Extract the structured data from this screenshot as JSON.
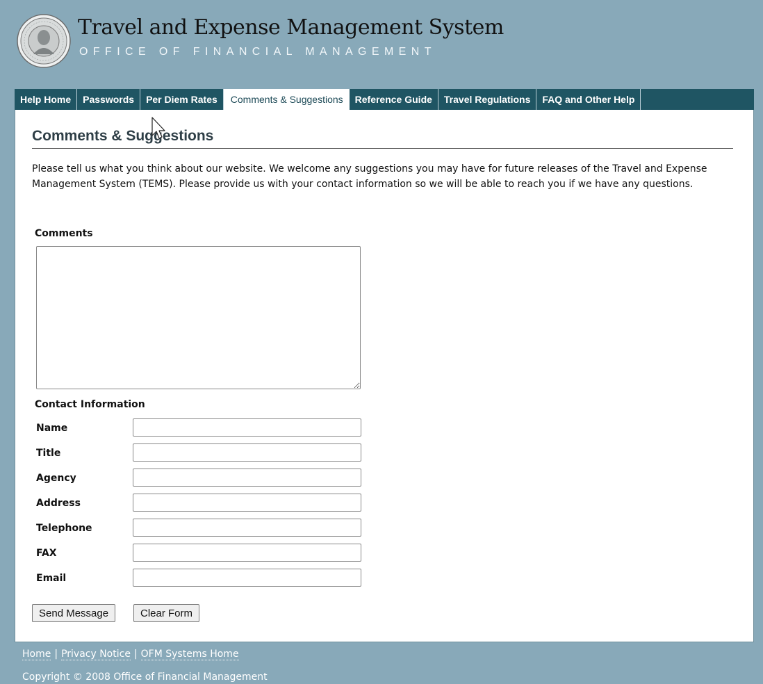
{
  "header": {
    "title": "Travel and Expense Management System",
    "subtitle": "OFFICE OF FINANCIAL MANAGEMENT",
    "seal_icon": "washington-state-seal-icon"
  },
  "nav": {
    "tabs": [
      {
        "label": "Help Home",
        "active": false
      },
      {
        "label": "Passwords",
        "active": false
      },
      {
        "label": "Per Diem Rates",
        "active": false
      },
      {
        "label": "Comments & Suggestions",
        "active": true
      },
      {
        "label": "Reference Guide",
        "active": false
      },
      {
        "label": "Travel Regulations",
        "active": false
      },
      {
        "label": "FAQ and Other Help",
        "active": false
      }
    ]
  },
  "page": {
    "title": "Comments & Suggestions",
    "intro": "Please tell us what you think about our website. We welcome any suggestions you may have for future releases of the Travel and Expense Management System (TEMS). Please provide us with your contact information so we will be able to reach you if we have any questions."
  },
  "form": {
    "comments_label": "Comments",
    "comments_value": "",
    "contact_heading": "Contact Information",
    "fields": {
      "name": {
        "label": "Name",
        "value": ""
      },
      "title": {
        "label": "Title",
        "value": ""
      },
      "agency": {
        "label": "Agency",
        "value": ""
      },
      "address": {
        "label": "Address",
        "value": ""
      },
      "telephone": {
        "label": "Telephone",
        "value": ""
      },
      "fax": {
        "label": "FAX",
        "value": ""
      },
      "email": {
        "label": "Email",
        "value": ""
      }
    },
    "send_label": "Send Message",
    "clear_label": "Clear Form"
  },
  "footer": {
    "links": [
      "Home",
      "Privacy Notice",
      "OFM Systems Home"
    ],
    "copyright": "Copyright © 2008 Office of Financial Management"
  },
  "colors": {
    "background": "#88a9b9",
    "nav_bar": "#1f5563",
    "content": "#ffffff"
  }
}
